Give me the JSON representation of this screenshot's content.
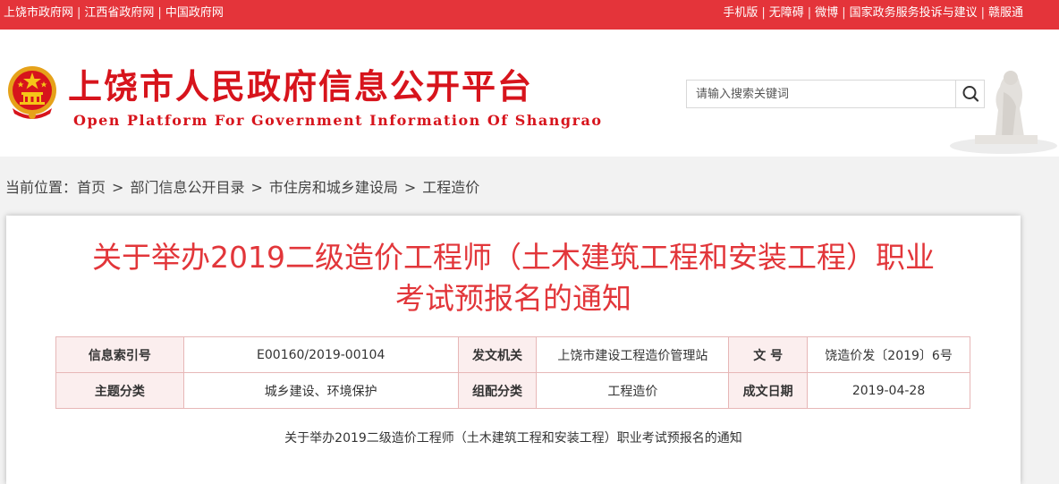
{
  "topbar": {
    "left_links": [
      "上饶市政府网",
      "江西省政府网",
      "中国政府网"
    ],
    "right_links": [
      "手机版",
      "无障碍",
      "微博",
      "国家政务服务投诉与建议",
      "赣服通"
    ]
  },
  "header": {
    "title": "上饶市人民政府信息公开平台",
    "subtitle": "Open Platform For Government Information Of Shangrao",
    "search_placeholder": "请输入搜索关键词"
  },
  "breadcrumb": {
    "label": "当前位置：",
    "items": [
      "首页",
      "部门信息公开目录",
      "市住房和城乡建设局",
      "工程造价"
    ]
  },
  "article": {
    "title_line1": "关于举办2019二级造价工程师（土木建筑工程和安装工程）职业",
    "title_line2": "考试预报名的通知",
    "summary": "关于举办2019二级造价工程师（土木建筑工程和安装工程）职业考试预报名的通知"
  },
  "meta": {
    "index_label": "信息索引号",
    "index_value": "E00160/2019-00104",
    "issuer_label": "发文机关",
    "issuer_value": "上饶市建设工程造价管理站",
    "doc_no_label": "文 号",
    "doc_no_value": "饶造价发〔2019〕6号",
    "topic_label": "主题分类",
    "topic_value": "城乡建设、环境保护",
    "org_label": "组配分类",
    "org_value": "工程造价",
    "date_label": "成文日期",
    "date_value": "2019-04-28"
  },
  "colors": {
    "topbar_bg": "#e4343a",
    "title_red": "#d7141c",
    "doc_title_red": "#e2363a"
  },
  "icons": [
    "national-emblem-icon",
    "search-icon",
    "statue-decoration"
  ]
}
